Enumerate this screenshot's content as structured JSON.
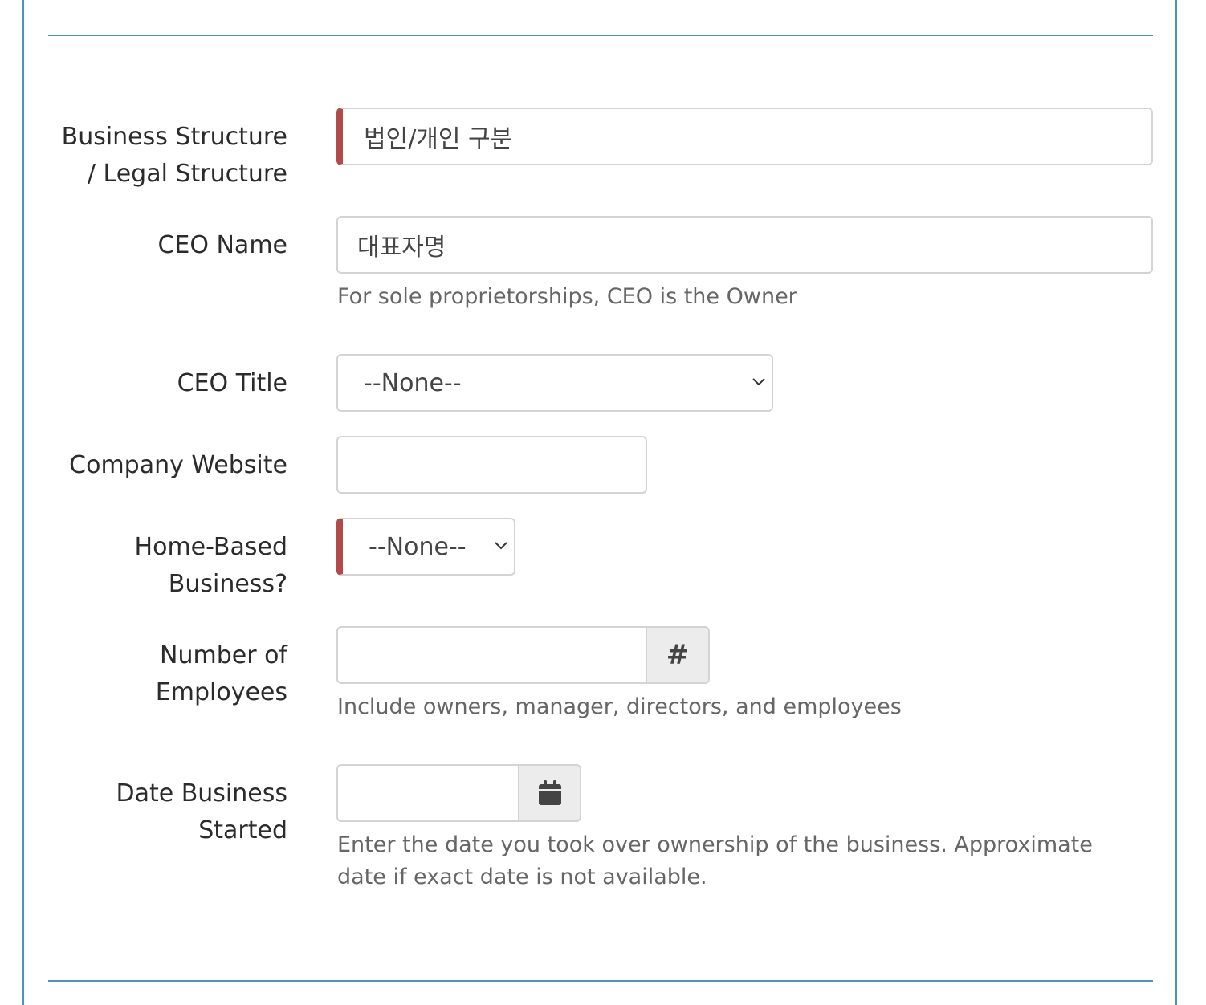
{
  "fields": {
    "business_structure": {
      "label": "Business Structure / Legal Structure",
      "value": "법인/개인 구분"
    },
    "ceo_name": {
      "label": "CEO Name",
      "value": "대표자명",
      "help": "For sole proprietorships, CEO is the Owner"
    },
    "ceo_title": {
      "label": "CEO Title",
      "selected": "--None--"
    },
    "company_website": {
      "label": "Company Website",
      "value": ""
    },
    "home_based": {
      "label": "Home-Based Business?",
      "selected": "--None--"
    },
    "employees": {
      "label": "Number of Employees",
      "value": "",
      "addon": "#",
      "help": "Include owners, manager, directors, and employees"
    },
    "date_started": {
      "label": "Date Business Started",
      "value": "",
      "addon_icon": "calendar-icon",
      "help": "Enter the date you took over ownership of the business. Approximate date if exact date is not available."
    }
  },
  "colors": {
    "frame": "#4a97b3",
    "required_marker": "#b24a4a",
    "border": "#d4d4d4",
    "addon_bg": "#ececec",
    "help_text": "#666666"
  }
}
